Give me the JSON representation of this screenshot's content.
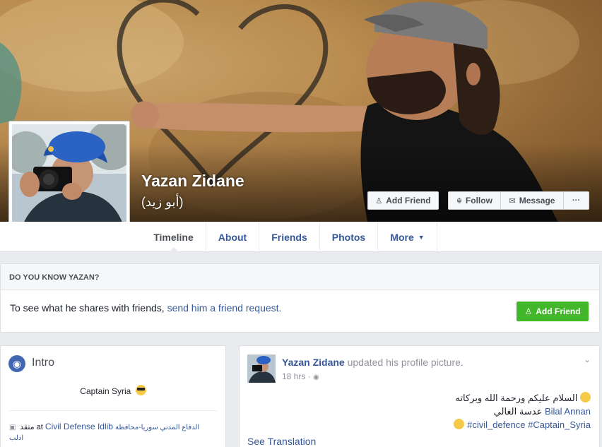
{
  "profile": {
    "name": "Yazan Zidane",
    "alt_name": "(أبو زيد)"
  },
  "actions": {
    "add_friend": "Add Friend",
    "follow": "Follow",
    "message": "Message",
    "more": "···"
  },
  "tabs": [
    {
      "label": "Timeline"
    },
    {
      "label": "About"
    },
    {
      "label": "Friends"
    },
    {
      "label": "Photos"
    },
    {
      "label": "More"
    }
  ],
  "know": {
    "heading": "DO YOU KNOW YAZAN?",
    "text": "To see what he shares with friends, ",
    "link": "send him a friend request.",
    "button": "Add Friend"
  },
  "intro": {
    "title": "Intro",
    "bio": "Captain Syria",
    "work_prefix": "متقد at",
    "work_link": "Civil Defense Idlib",
    "work_arabic_1": "الدفاع المدني سوريا-محافظة",
    "work_arabic_2": "ادلب"
  },
  "post": {
    "author": "Yazan Zidane",
    "action": "updated his profile picture.",
    "time": "18 hrs",
    "line1": "السلام عليكم ورحمة الله وبركاته",
    "line2_text": "عدسة الغالي",
    "line2_link": "Bilal Annan",
    "line3": "#civil_defence #Captain_Syria",
    "see_translation": "See Translation"
  },
  "colors": {
    "fb_blue": "#4267b2",
    "link": "#365899",
    "green": "#42b72a",
    "background": "#e9ebee"
  }
}
